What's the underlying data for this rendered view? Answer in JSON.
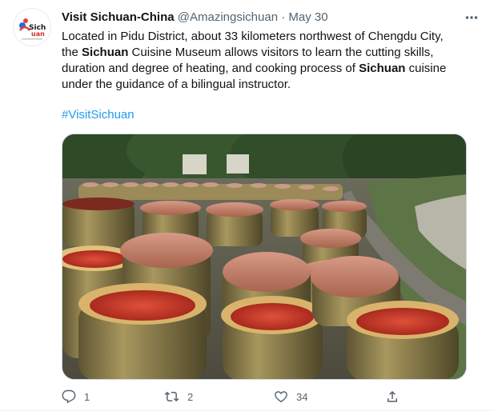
{
  "tweet": {
    "avatar": {
      "logo_text": "Sichuan",
      "tagline": "Sichuan more than pandas"
    },
    "display_name": "Visit Sichuan-China",
    "handle": "@Amazingsichuan",
    "separator": " · ",
    "date": "May 30",
    "text_parts": [
      "Located in Pidu District, about 33 kilometers northwest of Chengdu City, the ",
      "Sichuan",
      " Cuisine Museum allows visitors to learn the cutting skills, duration and degree of heating, and cooking process of ",
      "Sichuan",
      " cuisine under the guidance of a bilingual instructor."
    ],
    "hashtag": "#VisitSichuan",
    "stats": {
      "replies": "1",
      "retweets": "2",
      "likes": "34"
    }
  },
  "icons": [
    "more-icon",
    "reply-icon",
    "retweet-icon",
    "like-icon",
    "share-icon"
  ],
  "colors": {
    "accent": "#1d9bf0",
    "secondary_text": "#536471",
    "primary_text": "#0f1419"
  }
}
